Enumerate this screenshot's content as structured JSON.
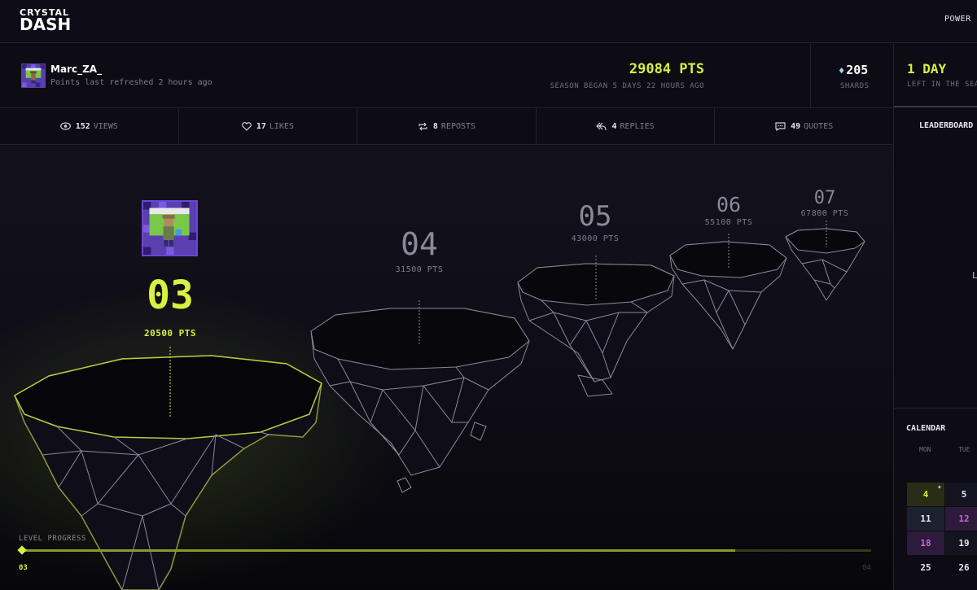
{
  "brand": {
    "line1": "CRYSTAL",
    "line2": "DASH"
  },
  "nav": {
    "power_link": "POWER P"
  },
  "profile": {
    "username": "Marc_ZA_",
    "refresh_text": "Points last refreshed 2 hours ago",
    "points": "29084 PTS",
    "season_text": "SEASON BEGAN 5 DAYS 22 HOURS AGO",
    "shards_value": "205",
    "shards_label": "SHARDS"
  },
  "season": {
    "days_value": "1 DAY",
    "days_label": "LEFT IN THE SEA"
  },
  "stats": [
    {
      "icon": "eye-icon",
      "value": "152",
      "label": "VIEWS"
    },
    {
      "icon": "heart-icon",
      "value": "17",
      "label": "LIKES"
    },
    {
      "icon": "repost-icon",
      "value": "8",
      "label": "REPOSTS"
    },
    {
      "icon": "reply-icon",
      "value": "4",
      "label": "REPLIES"
    },
    {
      "icon": "quote-icon",
      "value": "49",
      "label": "QUOTES"
    }
  ],
  "levels": [
    {
      "number": "03",
      "points": "20500 PTS",
      "current": true
    },
    {
      "number": "04",
      "points": "31500 PTS"
    },
    {
      "number": "05",
      "points": "43000 PTS"
    },
    {
      "number": "06",
      "points": "55100 PTS"
    },
    {
      "number": "07",
      "points": "67800 PTS"
    }
  ],
  "progress": {
    "label": "LEVEL PROGRESS",
    "start": "03",
    "end": "04",
    "fraction": 0.84
  },
  "leaderboard": {
    "title": "LEADERBOARD",
    "partial_text": "L"
  },
  "calendar": {
    "title": "CALENDAR",
    "days_of_week": [
      "MON",
      "TUE"
    ],
    "rows": [
      [
        "4",
        "5"
      ],
      [
        "11",
        "12"
      ],
      [
        "18",
        "19"
      ],
      [
        "25",
        "26"
      ]
    ]
  },
  "colors": {
    "accent": "#d8f040",
    "purple": "#c46ad8",
    "gem": "#9fd8ff"
  }
}
